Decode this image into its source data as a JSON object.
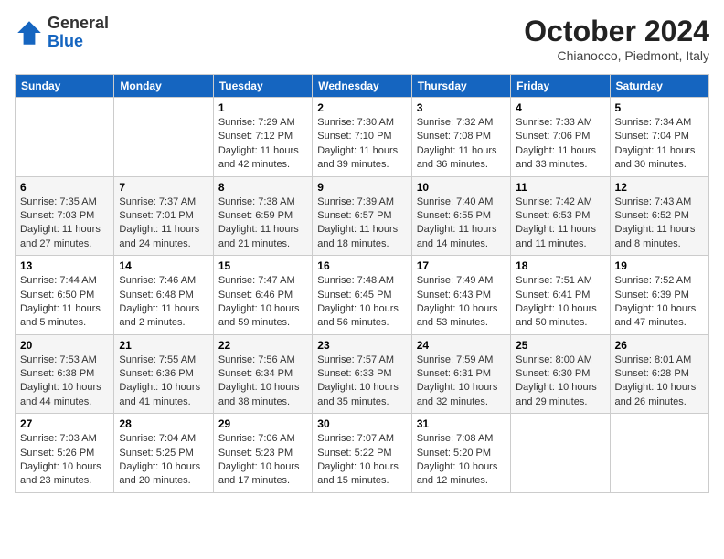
{
  "header": {
    "logo_general": "General",
    "logo_blue": "Blue",
    "month": "October 2024",
    "location": "Chianocco, Piedmont, Italy"
  },
  "weekdays": [
    "Sunday",
    "Monday",
    "Tuesday",
    "Wednesday",
    "Thursday",
    "Friday",
    "Saturday"
  ],
  "weeks": [
    [
      null,
      null,
      {
        "day": 1,
        "sunrise": "7:29 AM",
        "sunset": "7:12 PM",
        "daylight": "11 hours and 42 minutes."
      },
      {
        "day": 2,
        "sunrise": "7:30 AM",
        "sunset": "7:10 PM",
        "daylight": "11 hours and 39 minutes."
      },
      {
        "day": 3,
        "sunrise": "7:32 AM",
        "sunset": "7:08 PM",
        "daylight": "11 hours and 36 minutes."
      },
      {
        "day": 4,
        "sunrise": "7:33 AM",
        "sunset": "7:06 PM",
        "daylight": "11 hours and 33 minutes."
      },
      {
        "day": 5,
        "sunrise": "7:34 AM",
        "sunset": "7:04 PM",
        "daylight": "11 hours and 30 minutes."
      }
    ],
    [
      {
        "day": 6,
        "sunrise": "7:35 AM",
        "sunset": "7:03 PM",
        "daylight": "11 hours and 27 minutes."
      },
      {
        "day": 7,
        "sunrise": "7:37 AM",
        "sunset": "7:01 PM",
        "daylight": "11 hours and 24 minutes."
      },
      {
        "day": 8,
        "sunrise": "7:38 AM",
        "sunset": "6:59 PM",
        "daylight": "11 hours and 21 minutes."
      },
      {
        "day": 9,
        "sunrise": "7:39 AM",
        "sunset": "6:57 PM",
        "daylight": "11 hours and 18 minutes."
      },
      {
        "day": 10,
        "sunrise": "7:40 AM",
        "sunset": "6:55 PM",
        "daylight": "11 hours and 14 minutes."
      },
      {
        "day": 11,
        "sunrise": "7:42 AM",
        "sunset": "6:53 PM",
        "daylight": "11 hours and 11 minutes."
      },
      {
        "day": 12,
        "sunrise": "7:43 AM",
        "sunset": "6:52 PM",
        "daylight": "11 hours and 8 minutes."
      }
    ],
    [
      {
        "day": 13,
        "sunrise": "7:44 AM",
        "sunset": "6:50 PM",
        "daylight": "11 hours and 5 minutes."
      },
      {
        "day": 14,
        "sunrise": "7:46 AM",
        "sunset": "6:48 PM",
        "daylight": "11 hours and 2 minutes."
      },
      {
        "day": 15,
        "sunrise": "7:47 AM",
        "sunset": "6:46 PM",
        "daylight": "10 hours and 59 minutes."
      },
      {
        "day": 16,
        "sunrise": "7:48 AM",
        "sunset": "6:45 PM",
        "daylight": "10 hours and 56 minutes."
      },
      {
        "day": 17,
        "sunrise": "7:49 AM",
        "sunset": "6:43 PM",
        "daylight": "10 hours and 53 minutes."
      },
      {
        "day": 18,
        "sunrise": "7:51 AM",
        "sunset": "6:41 PM",
        "daylight": "10 hours and 50 minutes."
      },
      {
        "day": 19,
        "sunrise": "7:52 AM",
        "sunset": "6:39 PM",
        "daylight": "10 hours and 47 minutes."
      }
    ],
    [
      {
        "day": 20,
        "sunrise": "7:53 AM",
        "sunset": "6:38 PM",
        "daylight": "10 hours and 44 minutes."
      },
      {
        "day": 21,
        "sunrise": "7:55 AM",
        "sunset": "6:36 PM",
        "daylight": "10 hours and 41 minutes."
      },
      {
        "day": 22,
        "sunrise": "7:56 AM",
        "sunset": "6:34 PM",
        "daylight": "10 hours and 38 minutes."
      },
      {
        "day": 23,
        "sunrise": "7:57 AM",
        "sunset": "6:33 PM",
        "daylight": "10 hours and 35 minutes."
      },
      {
        "day": 24,
        "sunrise": "7:59 AM",
        "sunset": "6:31 PM",
        "daylight": "10 hours and 32 minutes."
      },
      {
        "day": 25,
        "sunrise": "8:00 AM",
        "sunset": "6:30 PM",
        "daylight": "10 hours and 29 minutes."
      },
      {
        "day": 26,
        "sunrise": "8:01 AM",
        "sunset": "6:28 PM",
        "daylight": "10 hours and 26 minutes."
      }
    ],
    [
      {
        "day": 27,
        "sunrise": "7:03 AM",
        "sunset": "5:26 PM",
        "daylight": "10 hours and 23 minutes."
      },
      {
        "day": 28,
        "sunrise": "7:04 AM",
        "sunset": "5:25 PM",
        "daylight": "10 hours and 20 minutes."
      },
      {
        "day": 29,
        "sunrise": "7:06 AM",
        "sunset": "5:23 PM",
        "daylight": "10 hours and 17 minutes."
      },
      {
        "day": 30,
        "sunrise": "7:07 AM",
        "sunset": "5:22 PM",
        "daylight": "10 hours and 15 minutes."
      },
      {
        "day": 31,
        "sunrise": "7:08 AM",
        "sunset": "5:20 PM",
        "daylight": "10 hours and 12 minutes."
      },
      null,
      null
    ]
  ]
}
